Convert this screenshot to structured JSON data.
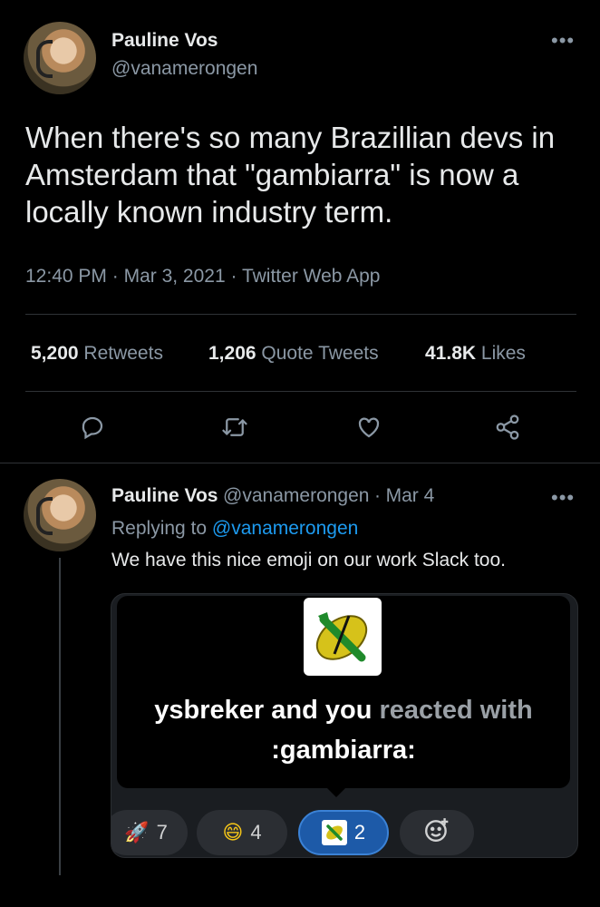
{
  "tweet": {
    "author_name": "Pauline Vos",
    "author_handle": "@vanamerongen",
    "more_label": "•••",
    "text": "When there's so many Brazillian devs in Amsterdam that \"gambiarra\" is now a locally known industry term.",
    "time": "12:40 PM",
    "sep1": "·",
    "date": "Mar 3, 2021",
    "sep2": "·",
    "source": "Twitter Web App",
    "stats": {
      "retweets_count": "5,200",
      "retweets_label": "Retweets",
      "quotes_count": "1,206",
      "quotes_label": "Quote Tweets",
      "likes_count": "41.8K",
      "likes_label": "Likes"
    },
    "icons": [
      "reply-icon",
      "retweet-icon",
      "like-icon",
      "share-icon"
    ]
  },
  "reply": {
    "author_name": "Pauline Vos",
    "author_handle": "@vanamerongen",
    "sep": "·",
    "date": "Mar 4",
    "more_label": "•••",
    "replying_prefix": "Replying to",
    "replying_to": "@vanamerongen",
    "text": "We have this nice emoji on our work Slack too.",
    "slack": {
      "tooltip_names": "ysbreker and you",
      "tooltip_reacted": "reacted with",
      "tooltip_emoji": ":gambiarra:",
      "reactions": [
        {
          "icon": "rocket-icon",
          "glyph": "🚀",
          "count": "7"
        },
        {
          "icon": "grin-icon",
          "glyph": "😄",
          "count": "4"
        },
        {
          "icon": "gambiarra-icon",
          "glyph": "",
          "count": "2"
        }
      ],
      "add_reaction_icon": "add-reaction-icon"
    }
  },
  "colors": {
    "background": "#000000",
    "text": "#e7e9ea",
    "muted": "#8b98a5",
    "link": "#1d9bf0",
    "active_reaction": "#1d5aa8"
  }
}
